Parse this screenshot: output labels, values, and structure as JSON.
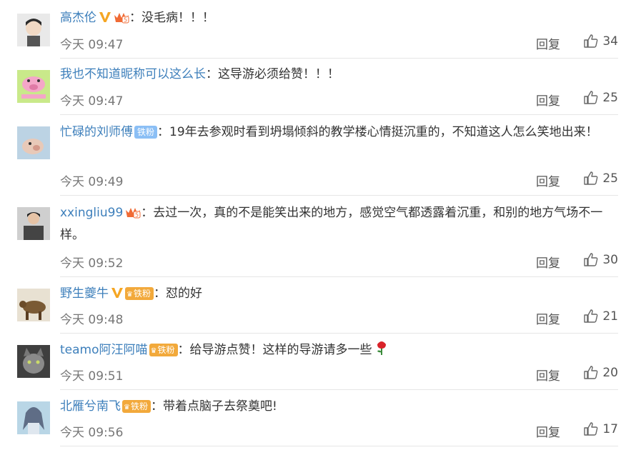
{
  "colors": {
    "username": "#3d7fbb",
    "meta": "#777777",
    "divider": "#e6e6e6"
  },
  "reply_label": "回复",
  "comments": [
    {
      "user": "高杰伦",
      "sep": "：",
      "text": "没毛病！！！",
      "time": "今天 09:47",
      "likes": "34"
    },
    {
      "user": "我也不知道昵称可以这么长",
      "sep": "：",
      "text": "这导游必须给赞！！！",
      "time": "今天 09:47",
      "likes": "25"
    },
    {
      "user": "忙碌的刘师傅",
      "badge": "铁粉",
      "sep": "：",
      "text": "19年去参观时看到坍塌倾斜的教学楼心情挺沉重的，不知道这人怎么笑地出来！",
      "time": "今天 09:49",
      "likes": "25"
    },
    {
      "user": "xxingliu99",
      "sep": "：",
      "text": "去过一次，真的不是能笑出来的地方，感觉空气都透露着沉重，和别的地方气场不一样。",
      "time": "今天 09:52",
      "likes": "30"
    },
    {
      "user": "野生夔牛",
      "badge": "铁粉",
      "sep": "：",
      "text": "怼的好",
      "time": "今天 09:48",
      "likes": "21"
    },
    {
      "user": "teamo阿汪阿喵",
      "badge": "铁粉",
      "sep": "：",
      "text": "给导游点赞！这样的导游请多一些",
      "time": "今天 09:51",
      "likes": "20"
    },
    {
      "user": "北雁兮南飞",
      "badge": "铁粉",
      "sep": "：",
      "text": "带着点脑子去祭奠吧!",
      "time": "今天 09:56",
      "likes": "17"
    }
  ]
}
